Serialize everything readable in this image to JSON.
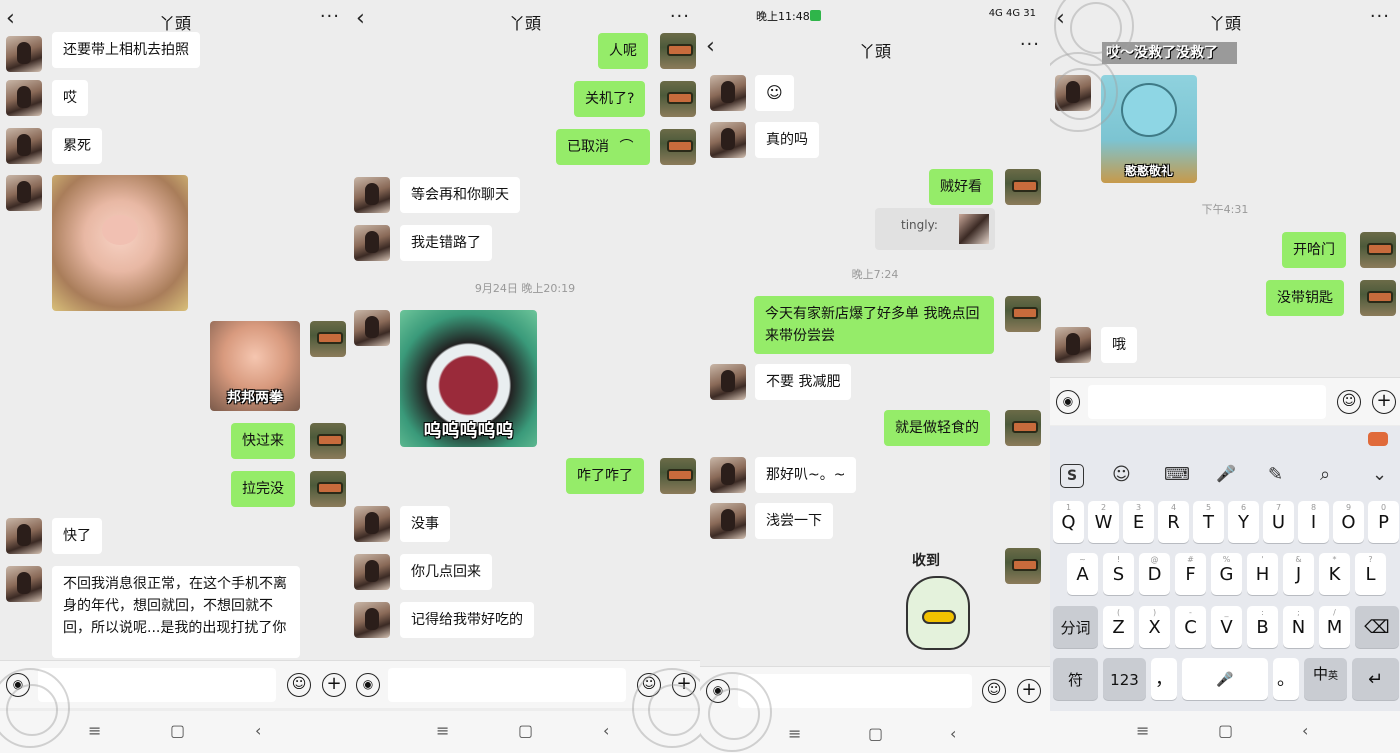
{
  "panels": {
    "p1": {
      "title": "丫頭",
      "messages": [
        {
          "text": "还要带上相机去拍照"
        },
        {
          "text": "哎"
        },
        {
          "text": "累死"
        },
        {
          "sticker_caption": "邦邦两拳"
        },
        {
          "text": "快过来"
        },
        {
          "text": "拉完没"
        },
        {
          "text": "快了"
        },
        {
          "text": "不回我消息很正常，在这个手机不离身的年代，想回就回，不想回就不回，所以说呢...是我的出现打扰了你"
        }
      ]
    },
    "p2": {
      "title": "丫頭",
      "timestamp": "9月24日 晚上20:19",
      "messages": [
        {
          "text": "人呢"
        },
        {
          "text": "关机了?"
        },
        {
          "text": "已取消"
        },
        {
          "text": "等会再和你聊天"
        },
        {
          "text": "我走错路了"
        },
        {
          "sticker_caption": "呜呜呜呜呜"
        },
        {
          "text": "咋了咋了"
        },
        {
          "text": "没事"
        },
        {
          "text": "你几点回来"
        },
        {
          "text": "记得给我带好吃的"
        }
      ]
    },
    "p3": {
      "status_time": "晚上11:48",
      "status_right": "4G 4G 31",
      "title": "丫頭",
      "timestamp": "晚上7:24",
      "messages": [
        {
          "text": "真的吗"
        },
        {
          "text": "贼好看"
        },
        {
          "text": "tingly:"
        },
        {
          "text": "今天有家新店爆了好多单 我晚点回来带份尝尝"
        },
        {
          "text": "不要 我减肥"
        },
        {
          "text": "就是做轻食的"
        },
        {
          "text": "那好叭~。~"
        },
        {
          "text": "浅尝一下"
        },
        {
          "sticker_caption": "收到"
        }
      ]
    },
    "p4": {
      "title": "丫頭",
      "sticker_top_caption": "哎～没救了没救了",
      "sticker_caption": "憨憨敬礼",
      "timestamp": "下午4:31",
      "messages": [
        {
          "text": "开哈门"
        },
        {
          "text": "没带钥匙"
        },
        {
          "text": "哦"
        }
      ],
      "keyboard": {
        "row1": [
          "Q",
          "W",
          "E",
          "R",
          "T",
          "Y",
          "U",
          "I",
          "O",
          "P"
        ],
        "row1_hints": [
          "1",
          "2",
          "3",
          "4",
          "5",
          "6",
          "7",
          "8",
          "9",
          "0"
        ],
        "row2": [
          "A",
          "S",
          "D",
          "F",
          "G",
          "H",
          "J",
          "K",
          "L"
        ],
        "row2_hints": [
          "~",
          "!",
          "@",
          "#",
          "%",
          "'",
          "&",
          "*",
          "?"
        ],
        "row3": [
          "Z",
          "X",
          "C",
          "V",
          "B",
          "N",
          "M"
        ],
        "row3_hints": [
          "(",
          ")",
          "-",
          "_",
          ":",
          ";",
          "/"
        ],
        "fenci": "分词",
        "fu": "符",
        "num": "123",
        "comma": "，",
        "period": "。",
        "zhong": "中",
        "ying": "英"
      }
    }
  },
  "icons": {
    "back": "‹",
    "more": "···",
    "voice": "◉",
    "emoji": "☺",
    "plus": "+",
    "nav_menu": "≡",
    "nav_home": "▢",
    "nav_back": "‹",
    "kb_logo": "S",
    "kb_smile": "☺",
    "kb_grid": "⌨",
    "kb_mic": "🎤",
    "kb_pen": "✎",
    "kb_search": "⌕",
    "kb_down": "⌄",
    "delete": "⌫",
    "enter": "↵"
  },
  "colors": {
    "sent_bubble": "#95ec69",
    "received_bubble": "#ffffff",
    "background": "#ededed"
  }
}
